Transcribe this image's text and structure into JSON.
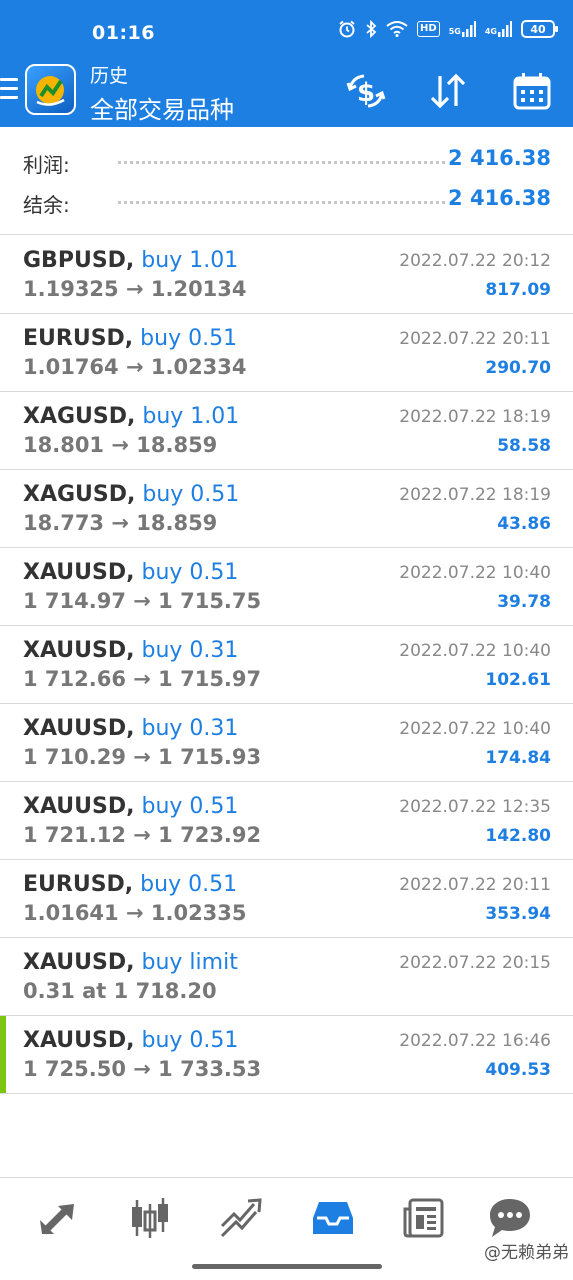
{
  "status_bar": {
    "time": "01:16",
    "hd": "HD",
    "net1": "5G",
    "net2": "4G",
    "battery": "40"
  },
  "app_bar": {
    "title_top": "历史",
    "title_main": "全部交易品种",
    "icons": [
      "menu-icon",
      "app-logo",
      "currency-exchange-icon",
      "sort-icon",
      "calendar-icon"
    ]
  },
  "summary": {
    "profit_label": "利润:",
    "profit_value": "2 416.38",
    "balance_label": "结余:",
    "balance_value": "2 416.38"
  },
  "trades": [
    {
      "symbol": "GBPUSD,",
      "direction": "buy 1.01",
      "prices": "1.19325 → 1.20134",
      "datetime": "2022.07.22 20:12",
      "profit": "817.09"
    },
    {
      "symbol": "EURUSD,",
      "direction": "buy 0.51",
      "prices": "1.01764 → 1.02334",
      "datetime": "2022.07.22 20:11",
      "profit": "290.70"
    },
    {
      "symbol": "XAGUSD,",
      "direction": "buy 1.01",
      "prices": "18.801 → 18.859",
      "datetime": "2022.07.22 18:19",
      "profit": "58.58"
    },
    {
      "symbol": "XAGUSD,",
      "direction": "buy 0.51",
      "prices": "18.773 → 18.859",
      "datetime": "2022.07.22 18:19",
      "profit": "43.86"
    },
    {
      "symbol": "XAUUSD,",
      "direction": "buy 0.51",
      "prices": "1 714.97 → 1 715.75",
      "datetime": "2022.07.22 10:40",
      "profit": "39.78"
    },
    {
      "symbol": "XAUUSD,",
      "direction": "buy 0.31",
      "prices": "1 712.66 → 1 715.97",
      "datetime": "2022.07.22 10:40",
      "profit": "102.61"
    },
    {
      "symbol": "XAUUSD,",
      "direction": "buy 0.31",
      "prices": "1 710.29 → 1 715.93",
      "datetime": "2022.07.22 10:40",
      "profit": "174.84"
    },
    {
      "symbol": "XAUUSD,",
      "direction": "buy 0.51",
      "prices": "1 721.12 → 1 723.92",
      "datetime": "2022.07.22 12:35",
      "profit": "142.80"
    },
    {
      "symbol": "EURUSD,",
      "direction": "buy 0.51",
      "prices": "1.01641 → 1.02335",
      "datetime": "2022.07.22 20:11",
      "profit": "353.94"
    },
    {
      "symbol": "XAUUSD,",
      "direction": "buy limit",
      "prices": "0.31 at 1 718.20",
      "datetime": "2022.07.22 20:15",
      "profit": ""
    },
    {
      "symbol": "XAUUSD,",
      "direction": "buy 0.51",
      "prices": "1 725.50 → 1 733.53",
      "datetime": "2022.07.22 16:46",
      "profit": "409.53"
    }
  ],
  "bottom_nav": {
    "items": [
      "quotes-icon",
      "chart-icon",
      "trade-icon",
      "history-icon",
      "news-icon",
      "chat-icon"
    ],
    "active": "history-icon"
  },
  "watermark": "@无赖弟弟",
  "colors": {
    "header_bg": "#1e7fe3",
    "accent_blue": "#1e7fe3",
    "selected_marker": "#7cc511"
  }
}
